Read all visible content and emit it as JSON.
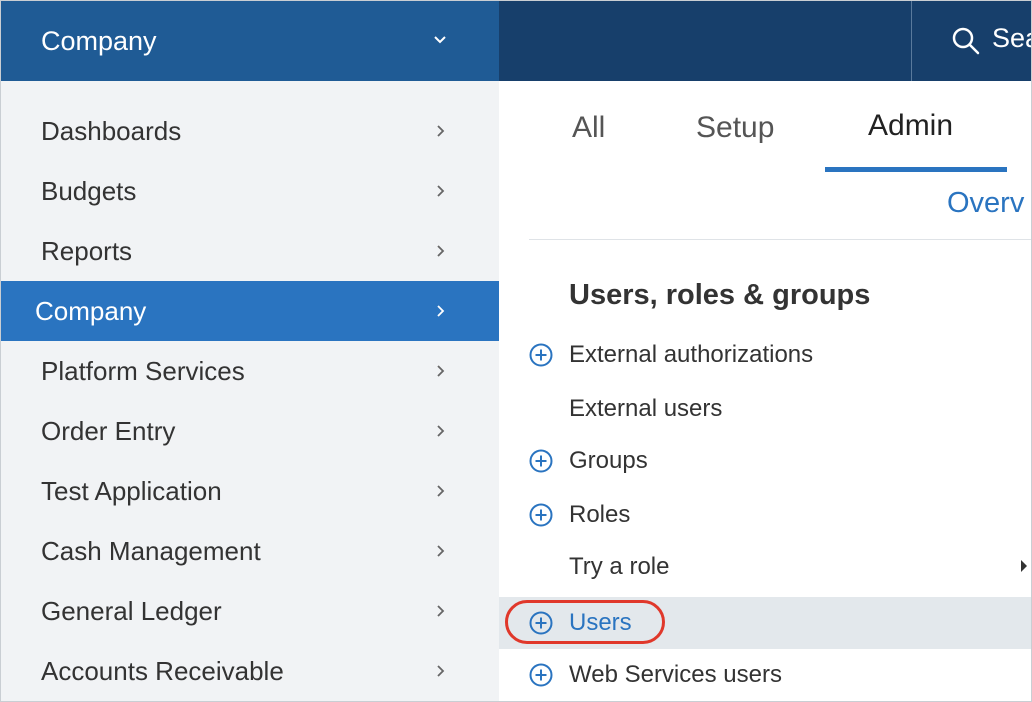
{
  "header": {
    "company_label": "Company",
    "search_label": "Sea"
  },
  "leftnav": {
    "items": [
      {
        "label": "Dashboards"
      },
      {
        "label": "Budgets"
      },
      {
        "label": "Reports"
      },
      {
        "label": "Company"
      },
      {
        "label": "Platform Services"
      },
      {
        "label": "Order Entry"
      },
      {
        "label": "Test Application"
      },
      {
        "label": "Cash Management"
      },
      {
        "label": "General Ledger"
      },
      {
        "label": "Accounts Receivable"
      }
    ],
    "active_item": "Company"
  },
  "tabs": [
    {
      "label": "All"
    },
    {
      "label": "Setup"
    },
    {
      "label": "Admin"
    }
  ],
  "active_tab": "Admin",
  "overview_link": "Overv",
  "section": {
    "title": "Users, roles & groups",
    "items": [
      {
        "label": "External authorizations",
        "has_plus": true
      },
      {
        "label": "External users",
        "has_plus": false
      },
      {
        "label": "Groups",
        "has_plus": true
      },
      {
        "label": "Roles",
        "has_plus": true
      },
      {
        "label": "Try a role",
        "has_plus": false,
        "has_submenu": true
      },
      {
        "label": "Users",
        "has_plus": true,
        "highlighted": true
      },
      {
        "label": "Web Services users",
        "has_plus": true
      }
    ]
  },
  "colors": {
    "topbar": "#173f6b",
    "company_switcher": "#1f5b95",
    "accent": "#2a74c0",
    "callout": "#e0382b"
  }
}
